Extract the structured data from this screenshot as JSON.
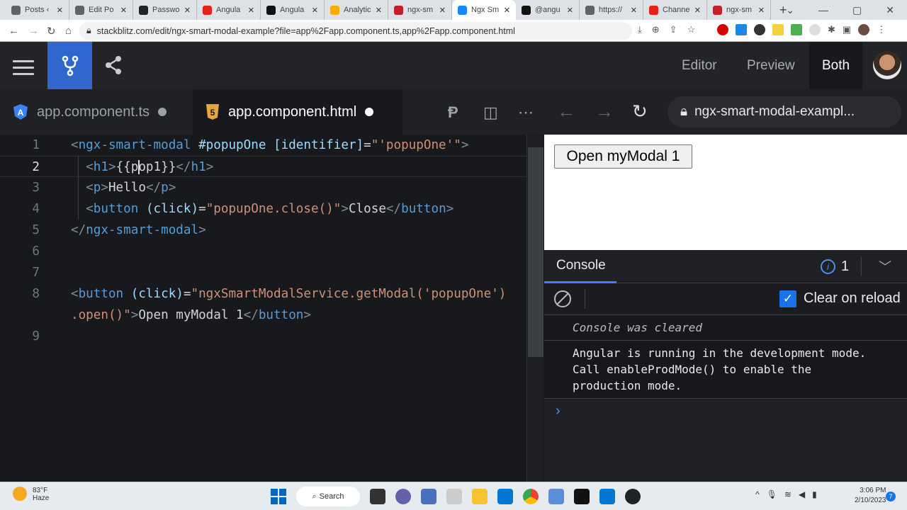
{
  "browser": {
    "tabs": [
      {
        "label": "Posts ‹",
        "color": "#5f6368"
      },
      {
        "label": "Edit Po",
        "color": "#5f6368"
      },
      {
        "label": "Passwo",
        "color": "#222"
      },
      {
        "label": "Angula",
        "color": "#e62117"
      },
      {
        "label": "Angula",
        "color": "#111"
      },
      {
        "label": "Analytic",
        "color": "#f9ab00"
      },
      {
        "label": "ngx-sm",
        "color": "#c12127"
      },
      {
        "label": "Ngx Sm",
        "color": "#1389fd",
        "active": true
      },
      {
        "label": "@angu",
        "color": "#111"
      },
      {
        "label": "https://",
        "color": "#5f6368"
      },
      {
        "label": "Channe",
        "color": "#e62117"
      },
      {
        "label": "ngx-sm",
        "color": "#c12127"
      }
    ],
    "new_tab": "+",
    "url": "stackblitz.com/edit/ngx-smart-modal-example?file=app%2Fapp.component.ts,app%2Fapp.component.html"
  },
  "header": {
    "views": [
      "Editor",
      "Preview",
      "Both"
    ],
    "active_view": "Both",
    "accent": "#2f67cf"
  },
  "files": {
    "tabs": [
      {
        "label": "app.component.ts",
        "icon": "angular-icon",
        "active": false
      },
      {
        "label": "app.component.html",
        "icon": "html5-icon",
        "active": true
      }
    ]
  },
  "editor": {
    "current_line": 2,
    "lines": [
      {
        "n": "1",
        "tokens": [
          [
            "p",
            "<"
          ],
          [
            "t",
            "ngx-smart-modal"
          ],
          [
            "x",
            " "
          ],
          [
            "a",
            "#popupOne"
          ],
          [
            "x",
            " "
          ],
          [
            "a",
            "[identifier]"
          ],
          [
            "x",
            "="
          ],
          [
            "s",
            "\"'popupOne'\""
          ],
          [
            "p",
            ">"
          ]
        ]
      },
      {
        "n": "2",
        "tokens": [
          [
            "x",
            "  "
          ],
          [
            "p",
            "<"
          ],
          [
            "t",
            "h1"
          ],
          [
            "p",
            ">"
          ],
          [
            "x",
            "{{pop1}}"
          ],
          [
            "p",
            "</"
          ],
          [
            "t",
            "h1"
          ],
          [
            "p",
            ">"
          ]
        ]
      },
      {
        "n": "3",
        "tokens": [
          [
            "x",
            "  "
          ],
          [
            "p",
            "<"
          ],
          [
            "t",
            "p"
          ],
          [
            "p",
            ">"
          ],
          [
            "x",
            "Hello"
          ],
          [
            "p",
            "</"
          ],
          [
            "t",
            "p"
          ],
          [
            "p",
            ">"
          ]
        ]
      },
      {
        "n": "4",
        "tokens": [
          [
            "x",
            "  "
          ],
          [
            "p",
            "<"
          ],
          [
            "t",
            "button"
          ],
          [
            "x",
            " "
          ],
          [
            "a",
            "(click)"
          ],
          [
            "x",
            "="
          ],
          [
            "s",
            "\"popupOne.close()\""
          ],
          [
            "p",
            ">"
          ],
          [
            "x",
            "Close"
          ],
          [
            "p",
            "</"
          ],
          [
            "t",
            "button"
          ],
          [
            "p",
            ">"
          ]
        ]
      },
      {
        "n": "5",
        "tokens": [
          [
            "p",
            "</"
          ],
          [
            "t",
            "ngx-smart-modal"
          ],
          [
            "p",
            ">"
          ]
        ]
      },
      {
        "n": "6",
        "tokens": []
      },
      {
        "n": "7",
        "tokens": []
      },
      {
        "n": "8",
        "tokens": [
          [
            "p",
            "<"
          ],
          [
            "t",
            "button"
          ],
          [
            "x",
            " "
          ],
          [
            "a",
            "(click)"
          ],
          [
            "x",
            "="
          ],
          [
            "s",
            "\"ngxSmartModalService.getModal('popupOne')"
          ]
        ]
      },
      {
        "n": "",
        "tokens": [
          [
            "s",
            ".open()\""
          ],
          [
            "p",
            ">"
          ],
          [
            "x",
            "Open myModal 1"
          ],
          [
            "p",
            "</"
          ],
          [
            "t",
            "button"
          ],
          [
            "p",
            ">"
          ]
        ]
      },
      {
        "n": "9",
        "tokens": []
      }
    ]
  },
  "preview": {
    "url": "ngx-smart-modal-exampl...",
    "button_label": "Open myModal 1"
  },
  "console": {
    "tab": "Console",
    "info_count": "1",
    "clear_on_reload_label": "Clear on reload",
    "clear_on_reload": true,
    "messages": [
      {
        "text": "Console was cleared",
        "italic": true
      },
      {
        "text": "Angular is running in the development mode.\nCall enableProdMode() to enable the\nproduction mode.",
        "italic": false
      }
    ],
    "prompt": "›"
  },
  "taskbar": {
    "temp": "83°F",
    "weather": "Haze",
    "search": "Search",
    "time": "3:06 PM",
    "date": "2/10/2023",
    "notifications": "7"
  }
}
